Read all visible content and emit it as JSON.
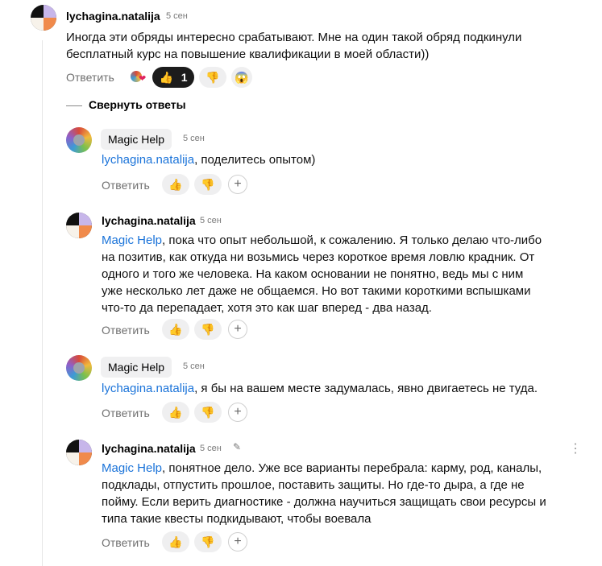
{
  "comment": {
    "author": "lychagina.natalija",
    "time": "5 сен",
    "text": "Иногда эти обряды интересно срабатывают. Мне на один такой обряд подкинули\nбесплатный курс на повышение квалификации в моей области))",
    "reply_label": "Ответить",
    "reactions": {
      "like_icon": "👍",
      "like_count": "1",
      "dislike_icon": "👎",
      "extra_icon": "😱",
      "heart_icon": "❤"
    }
  },
  "collapse_label": "Свернуть ответы",
  "replies": [
    {
      "author": "Magic Help",
      "time": "5 сен",
      "mention": "lychagina.natalija",
      "text": ", поделитесь опытом)",
      "reply_label": "Ответить",
      "like_icon": "👍",
      "dislike_icon": "👎",
      "plus_icon": "+"
    },
    {
      "author": "lychagina.natalija",
      "time": "5 сен",
      "mention": "Magic Help",
      "text": ", пока что опыт небольшой, к сожалению. Я только делаю что-либо\nна позитив, как откуда ни возьмись через короткое время ловлю крадник. От\nодного и того же человека. На каком основании не понятно, ведь мы с ним\nуже несколько лет даже не общаемся. Но вот такими короткими вспышками\nчто-то да перепадает, хотя это как шаг вперед - два назад.",
      "reply_label": "Ответить",
      "like_icon": "👍",
      "dislike_icon": "👎",
      "plus_icon": "+"
    },
    {
      "author": "Magic Help",
      "time": "5 сен",
      "mention": "lychagina.natalija",
      "text": ", я бы на вашем месте задумалась, явно двигаетесь не туда.",
      "reply_label": "Ответить",
      "like_icon": "👍",
      "dislike_icon": "👎",
      "plus_icon": "+"
    },
    {
      "author": "lychagina.natalija",
      "time": "5 сен",
      "mention": "Magic Help",
      "text": ", понятное дело. Уже все варианты перебрала: карму, род, каналы,\nподклады, отпустить прошлое, поставить защиты. Но где-то дыра, а где не\nпойму. Если верить диагностике - должна научиться защищать свои ресурсы и\nтипа такие квесты подкидывают, чтобы воевала",
      "reply_label": "Ответить",
      "like_icon": "👍",
      "dislike_icon": "👎",
      "plus_icon": "+",
      "edit_icon": "✎",
      "more_icon": "⋮"
    }
  ]
}
